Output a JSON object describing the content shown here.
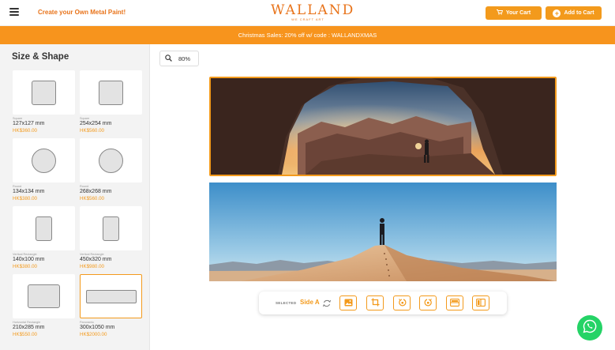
{
  "header": {
    "tagline": "Create your Own Metal Paint!",
    "logo_text": "WALLAND",
    "logo_sub": "WE CRAFT ART",
    "cart_label": "Your Cart",
    "add_label": "Add to Cart"
  },
  "banner": {
    "text": "Christmas Sales: 20% off w/ code : WALLANDXMAS"
  },
  "sidebar": {
    "title": "Size & Shape",
    "items": [
      {
        "cap": "Square",
        "dim": "127x127 mm",
        "price": "HK$360.00"
      },
      {
        "cap": "Square",
        "dim": "254x254 mm",
        "price": "HK$560.00"
      },
      {
        "cap": "Round",
        "dim": "134x134 mm",
        "price": "HK$380.00"
      },
      {
        "cap": "Round",
        "dim": "268x268 mm",
        "price": "HK$560.00"
      },
      {
        "cap": "Vertical Rectangle",
        "dim": "140x100 mm",
        "price": "HK$380.00"
      },
      {
        "cap": "Vertical Rectangle",
        "dim": "450x320 mm",
        "price": "HK$980.00"
      },
      {
        "cap": "Horizontal Rectangle",
        "dim": "210x285 mm",
        "price": "HK$550.00"
      },
      {
        "cap": "Panoramic",
        "dim": "300x1050 mm",
        "price": "HK$2000.00"
      }
    ]
  },
  "zoom": {
    "value": "80%"
  },
  "toolbar": {
    "selected_label": "SELECTED",
    "side_label": "Side A"
  },
  "colors": {
    "accent": "#f39a1c",
    "banner": "#f7941d",
    "whatsapp": "#25d366"
  },
  "icons": [
    "menu-icon",
    "cart-icon",
    "plus-circle-icon",
    "zoom-icon",
    "swap-icon",
    "image-icon",
    "crop-icon",
    "rotate-left-icon",
    "rotate-right-icon",
    "flip-horizontal-icon",
    "flip-vertical-icon",
    "whatsapp-icon"
  ]
}
